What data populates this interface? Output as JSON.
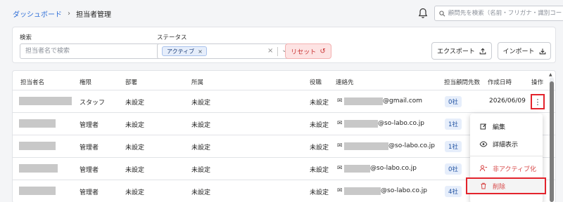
{
  "breadcrumb": {
    "home": "ダッシュボード",
    "separator": "›",
    "current": "担当者管理"
  },
  "header": {
    "search_placeholder": "顧問先を検索（名前・フリガナ・識別コード）"
  },
  "filters": {
    "keyword_label": "検索",
    "keyword_placeholder": "担当者名で検索",
    "status_label": "ステータス",
    "status_chip": "アクティブ",
    "chip_remove": "×",
    "clear": "×",
    "dropdown": "⌄",
    "reset_label": "リセット",
    "reset_icon": "↺",
    "export_label": "エクスポート",
    "export_icon": "upload-icon",
    "import_label": "インポート",
    "import_icon": "download-icon"
  },
  "table": {
    "columns": [
      "担当者名",
      "権限",
      "部署",
      "所属",
      "役職",
      "連絡先",
      "担当顧問先数",
      "作成日時",
      "操作"
    ],
    "rows": [
      {
        "role": "スタッフ",
        "dept": "未設定",
        "affil": "未設定",
        "position": "未設定",
        "email_domain": "@gmail.com",
        "count": "0社",
        "created": "2026/06/09"
      },
      {
        "role": "管理者",
        "dept": "未設定",
        "affil": "未設定",
        "position": "未設定",
        "email_domain": "@so-labo.co.jp",
        "count": "1社",
        "created": ""
      },
      {
        "role": "管理者",
        "dept": "未設定",
        "affil": "未設定",
        "position": "未設定",
        "email_domain": "@so-labo.co.jp",
        "count": "1社",
        "created": ""
      },
      {
        "role": "管理者",
        "dept": "未設定",
        "affil": "未設定",
        "position": "未設定",
        "email_domain": "@so-labo.co.jp",
        "count": "0社",
        "created": ""
      },
      {
        "role": "管理者",
        "dept": "未設定",
        "affil": "未設定",
        "position": "未設定",
        "email_domain": "@so-labo.co.jp",
        "count": "4社",
        "created": ""
      }
    ]
  },
  "row_menu": {
    "kebab": "⋮",
    "items": [
      {
        "label": "編集",
        "icon": "edit-icon"
      },
      {
        "label": "詳細表示",
        "icon": "eye-icon"
      },
      {
        "label": "非アクティブ化",
        "icon": "user-deactivate-icon"
      },
      {
        "label": "削除",
        "icon": "trash-icon"
      }
    ]
  },
  "colors": {
    "link": "#2f6fd8",
    "danger": "#d84a4a",
    "badge_bg": "#e6eefb",
    "highlight_border": "#e3232c"
  }
}
